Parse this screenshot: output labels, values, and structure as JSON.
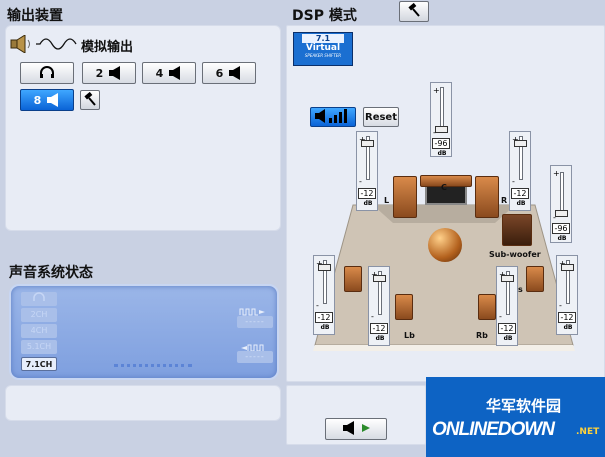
{
  "output_section": {
    "title": "输出装置",
    "mode_label": "模拟输出",
    "buttons": [
      {
        "label": "",
        "icon": "headphones-icon"
      },
      {
        "label": "2",
        "icon": "speaker-icon"
      },
      {
        "label": "4",
        "icon": "speaker-icon"
      },
      {
        "label": "6",
        "icon": "speaker-icon"
      },
      {
        "label": "8",
        "icon": "speaker-icon",
        "active": true
      }
    ]
  },
  "status_section": {
    "title": "声音系统状态",
    "channels": [
      "2CH",
      "4CH",
      "5.1CH",
      "7.1CH"
    ],
    "active_channel": "7.1CH",
    "io_slot_text": "-----"
  },
  "dsp_section": {
    "title": "DSP 模式",
    "dsp_button": {
      "line1": "7.1",
      "line2": "Virtual",
      "line3": "SPEAKER SHIFTER"
    },
    "reset_label": "Reset",
    "db_unit": "dB",
    "sliders": [
      {
        "name": "top",
        "value": "-96"
      },
      {
        "name": "left",
        "value": "-12"
      },
      {
        "name": "right",
        "value": "-12"
      },
      {
        "name": "sub",
        "value": "-96"
      },
      {
        "name": "side-left",
        "value": "-12"
      },
      {
        "name": "rear-left",
        "value": "-12"
      },
      {
        "name": "rear-right",
        "value": "-12"
      },
      {
        "name": "side-right",
        "value": "-12"
      }
    ],
    "speaker_labels": {
      "center": "C",
      "left": "L",
      "right": "R",
      "sub": "Sub-woofer",
      "lb": "Lb",
      "rb": "Rb",
      "s_left": "s",
      "s_right": "s"
    }
  },
  "watermark": {
    "line1": "华军软件园",
    "line2": "ONLINEDOWN",
    "suffix": ".NET"
  }
}
